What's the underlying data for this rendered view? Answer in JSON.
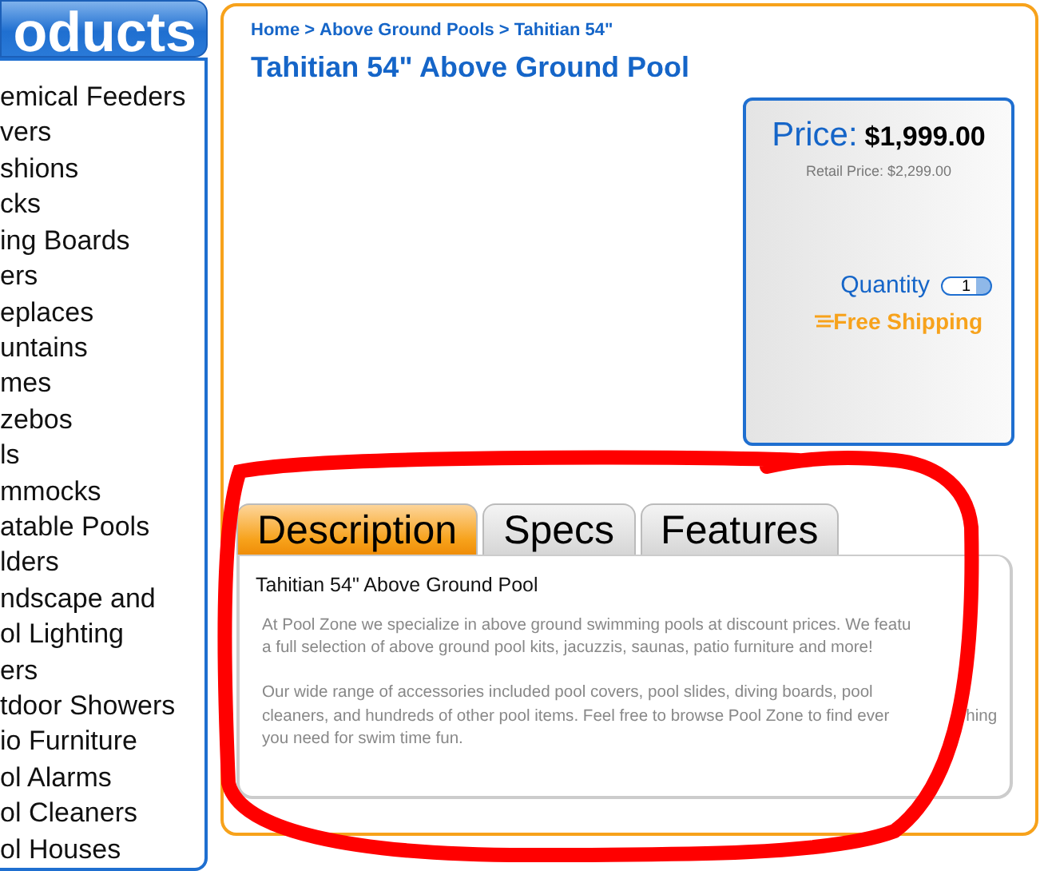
{
  "sidebar": {
    "title": "oducts",
    "items": [
      "emical Feeders",
      "vers",
      "shions",
      "cks",
      "ing Boards",
      "ers",
      "eplaces",
      "untains",
      "mes",
      "zebos",
      "ls",
      "mmocks",
      "atable Pools",
      "lders",
      "ndscape and",
      "ol Lighting",
      "ers",
      "tdoor Showers",
      "io Furniture",
      "ol Alarms",
      "ol Cleaners",
      "ol Houses"
    ]
  },
  "breadcrumb": [
    "Home",
    "Above Ground Pools",
    "Tahitian 54\""
  ],
  "breadcrumb_separator": ">",
  "title": "Tahitian 54\" Above Ground Pool",
  "price_box": {
    "label": "Price:",
    "price": "$1,999.00",
    "retail": "Retail Price: $2,299.00",
    "quantity_label": "Quantity",
    "quantity": "1",
    "shipping": "Free Shipping"
  },
  "tabs": [
    {
      "label": "Description",
      "selected": true
    },
    {
      "label": "Specs",
      "selected": false
    },
    {
      "label": "Features",
      "selected": false
    }
  ],
  "description": {
    "heading": "Tahitian 54\" Above Ground Pool",
    "paragraphs": [
      [
        [
          "At Pool Zone we specialize in above ground swimming pools at discount prices. We featu"
        ],
        [
          "a full selection of above ground pool kits, jacuzzis, saunas, patio furniture and more!"
        ]
      ],
      [
        [
          "Our wide range of accessories included pool covers, pool slides, diving boards, pool"
        ],
        [
          "cleaners, and hundreds of other pool items. Feel free to browse Pool Zone to find ever",
          "hing"
        ],
        [
          "you need for swim time fun."
        ]
      ]
    ]
  }
}
